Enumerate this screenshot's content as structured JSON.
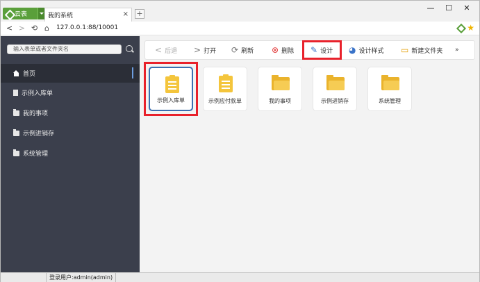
{
  "browser": {
    "app_tab_label": "云表",
    "page_tab_title": "我的系统",
    "url": "127.0.0.1:88/10001"
  },
  "sidebar": {
    "search_placeholder": "输入表单或者文件夹名",
    "items": [
      {
        "label": "首页",
        "icon": "home-icon",
        "active": true
      },
      {
        "label": "示例入库单",
        "icon": "document-icon"
      },
      {
        "label": "我的事项",
        "icon": "folder-icon"
      },
      {
        "label": "示例进销存",
        "icon": "folder-icon"
      },
      {
        "label": "系统管理",
        "icon": "folder-icon"
      }
    ]
  },
  "toolbar": {
    "back": "后退",
    "forward": "打开",
    "refresh": "刷新",
    "delete": "删除",
    "design": "设计",
    "design_style": "设计样式",
    "new_folder": "新建文件夹",
    "more": "»"
  },
  "tiles": [
    {
      "label": "示例入库单",
      "type": "form",
      "selected": true
    },
    {
      "label": "示例应付款单",
      "type": "form"
    },
    {
      "label": "我的事项",
      "type": "folder"
    },
    {
      "label": "示例进销存",
      "type": "folder"
    },
    {
      "label": "系统管理",
      "type": "folder"
    }
  ],
  "status": {
    "login_user": "登录用户:admin(admin)"
  },
  "colors": {
    "sidebar_bg": "#3b3f4c",
    "highlight": "#e8212b",
    "tile_icon": "#f4c53c",
    "app_green": "#5a9f3a"
  }
}
